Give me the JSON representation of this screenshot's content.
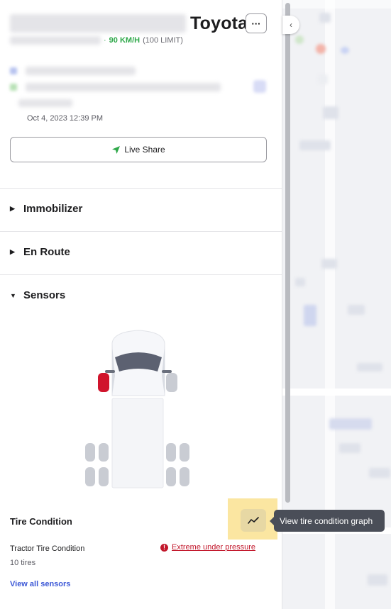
{
  "vehicle": {
    "make": "Toyota",
    "more_label": "···",
    "speed": "90 KM/H",
    "speed_limit": "(100 LIMIT)",
    "speed_separator": "·",
    "timestamp": "Oct 4, 2023 12:39 PM"
  },
  "actions": {
    "live_share_label": "Live Share"
  },
  "sections": [
    {
      "label": "Immobilizer",
      "caret": "▶",
      "expanded": false
    },
    {
      "label": "En Route",
      "caret": "▶",
      "expanded": false
    },
    {
      "label": "Sensors",
      "caret": "▼",
      "expanded": true
    }
  ],
  "sensors": {
    "tire_condition_title": "Tire Condition",
    "tooltip": "View tire condition graph",
    "tractor_label": "Tractor Tire Condition",
    "tire_count": "10 tires",
    "alert_icon": "!",
    "alert_text": "Extreme under pressure",
    "view_all": "View all sensors"
  },
  "map": {
    "collapse_icon": "‹"
  },
  "colors": {
    "speed_green": "#2fa84a",
    "alert_red": "#c2172b",
    "link_blue": "#3b57d6",
    "highlight_yellow": "#fbe6a1",
    "tire_alert_red": "#d0142c",
    "tire_normal": "#c9ccd3"
  },
  "icons": {
    "more": "ellipsis-icon",
    "live_share": "navigation-arrow-icon",
    "graph": "trend-line-icon",
    "alert": "exclamation-circle-icon",
    "collapse": "chevron-left-icon"
  }
}
